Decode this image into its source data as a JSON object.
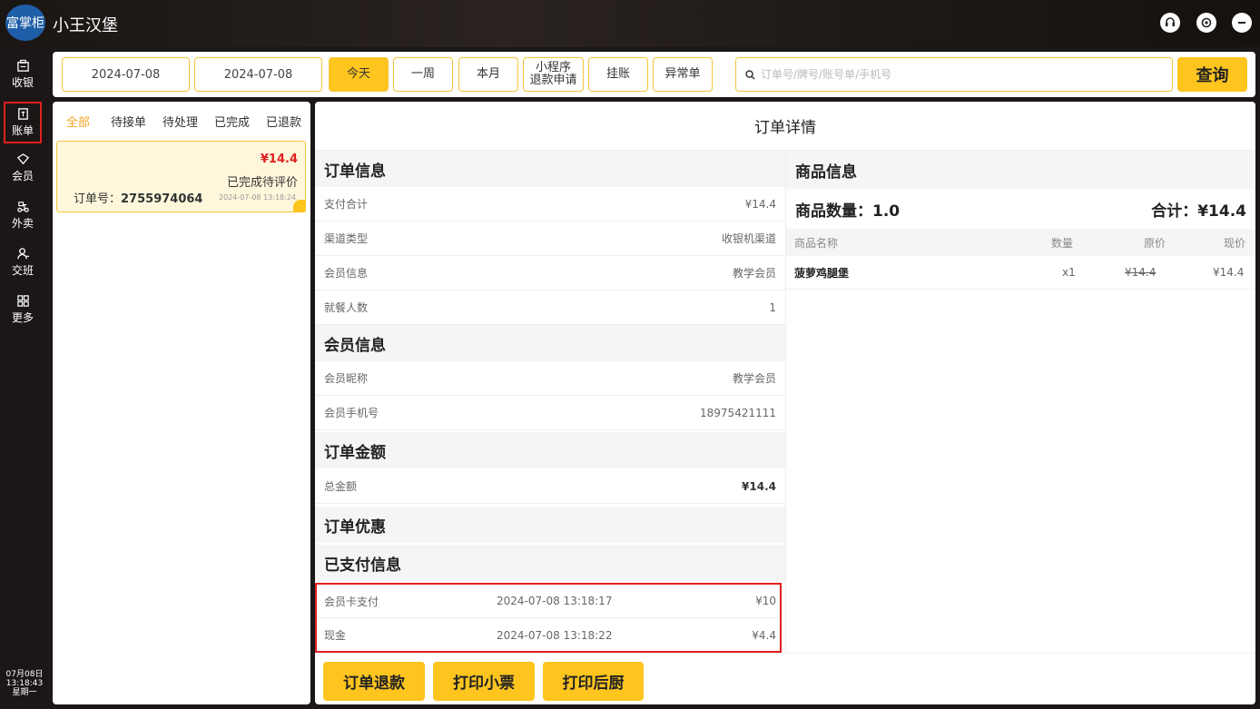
{
  "app": {
    "logo_text": "富掌柜",
    "title": "小王汉堡"
  },
  "sidebar": {
    "items": [
      {
        "label": "收银",
        "icon": "register-icon"
      },
      {
        "label": "账单",
        "icon": "bill-icon"
      },
      {
        "label": "会员",
        "icon": "member-icon"
      },
      {
        "label": "外卖",
        "icon": "delivery-icon"
      },
      {
        "label": "交班",
        "icon": "shift-icon"
      },
      {
        "label": "更多",
        "icon": "grid-icon"
      }
    ],
    "clock": {
      "date": "07月08日",
      "time": "13:18:43",
      "weekday": "星期一"
    }
  },
  "filters": {
    "start_date": "2024-07-08",
    "end_date": "2024-07-08",
    "buttons": [
      "今天",
      "一周",
      "本月",
      "小程序退款申请",
      "挂账",
      "异常单"
    ],
    "mini_line1": "小程序",
    "mini_line2": "退款申请",
    "search_placeholder": "订单号/牌号/账号单/手机号",
    "query_label": "查询"
  },
  "order_tabs": [
    "全部",
    "待接单",
    "待处理",
    "已完成",
    "已退款"
  ],
  "order_card": {
    "price": "¥14.4",
    "status": "已完成待评价",
    "order_label": "订单号：",
    "order_no": "2755974064",
    "time": "2024-07-08 13:18:24"
  },
  "detail": {
    "title": "订单详情",
    "order_info": {
      "head": "订单信息",
      "rows": [
        {
          "label": "支付合计",
          "value": "¥14.4"
        },
        {
          "label": "渠道类型",
          "value": "收银机渠道"
        },
        {
          "label": "会员信息",
          "value": "教学会员"
        },
        {
          "label": "就餐人数",
          "value": "1"
        }
      ]
    },
    "member_info": {
      "head": "会员信息",
      "rows": [
        {
          "label": "会员昵称",
          "value": "教学会员"
        },
        {
          "label": "会员手机号",
          "value": "18975421111"
        }
      ]
    },
    "amount": {
      "head": "订单金额",
      "label": "总金额",
      "value": "¥14.4"
    },
    "discount": {
      "head": "订单优惠"
    },
    "paid": {
      "head": "已支付信息",
      "rows": [
        {
          "method": "会员卡支付",
          "time": "2024-07-08 13:18:17",
          "amount": "¥10"
        },
        {
          "method": "现金",
          "time": "2024-07-08 13:18:22",
          "amount": "¥4.4"
        }
      ]
    },
    "goods": {
      "head": "商品信息",
      "count_label": "商品数量：1.0",
      "total_label": "合计：¥14.4",
      "columns": [
        "商品名称",
        "数量",
        "原价",
        "现价"
      ],
      "rows": [
        {
          "name": "菠萝鸡腿堡",
          "qty": "x1",
          "orig": "¥14.4",
          "now": "¥14.4"
        }
      ]
    },
    "actions": [
      "订单退款",
      "打印小票",
      "打印后厨"
    ]
  },
  "colors": {
    "accent": "#ffc51f",
    "price_red": "#e02020",
    "highlight_border": "#e02020",
    "logo_blue": "#1f5ea8"
  }
}
